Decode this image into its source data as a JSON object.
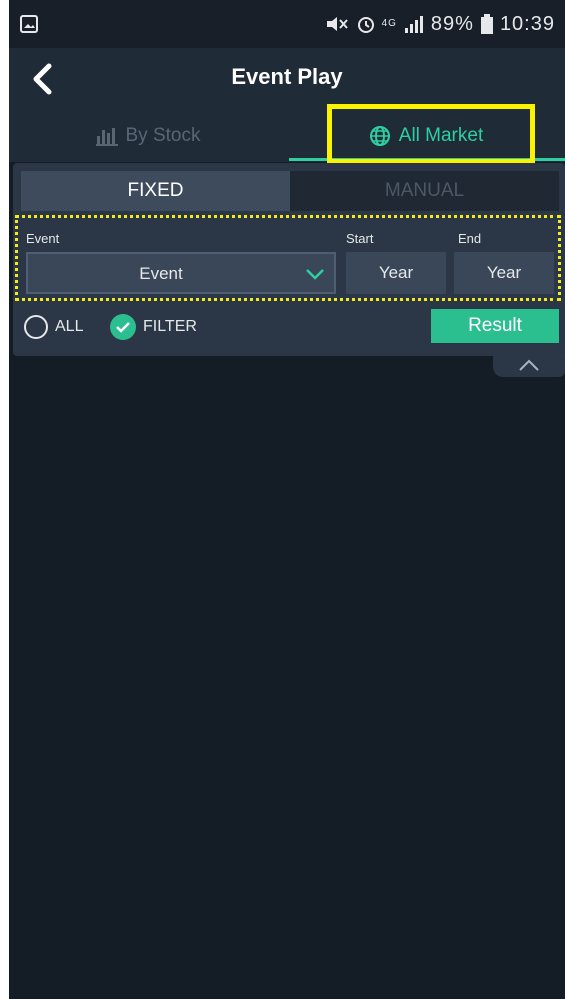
{
  "status_bar": {
    "battery_percent": "89%",
    "time": "10:39",
    "network": "4G"
  },
  "header": {
    "title": "Event Play",
    "back_icon": "chevron-left-icon"
  },
  "tabs": [
    {
      "label": "By Stock",
      "icon": "bar-chart-icon",
      "active": false
    },
    {
      "label": "All Market",
      "icon": "globe-icon",
      "active": true
    }
  ],
  "mode_toggle": {
    "fixed_label": "FIXED",
    "manual_label": "MANUAL",
    "selected": "FIXED"
  },
  "filters": {
    "event_label": "Event",
    "event_value": "Event",
    "start_label": "Start",
    "start_value": "Year",
    "end_label": "End",
    "end_value": "Year"
  },
  "options": {
    "all_label": "ALL",
    "filter_label": "FILTER",
    "filter_checked": true,
    "result_label": "Result"
  },
  "colors": {
    "accent": "#2ecfa0",
    "highlight": "#f9f200",
    "background": "#141c26"
  }
}
